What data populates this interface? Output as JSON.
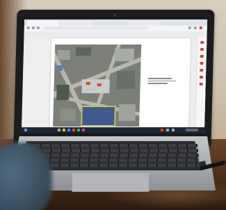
{
  "scene": {
    "subject": "laptop",
    "screen_content": "pdf-viewer-with-aerial-map",
    "colors": {
      "wall": "#d8cdbd",
      "desk": "#5a3a22",
      "laptop_lid": "#1c1c1e",
      "laptop_base": "#b3b5b8",
      "keyboard": "#2b2c2f",
      "taskbar": "#202734",
      "map_ground": "#7b7f77",
      "accent_red": "#e3402f"
    }
  }
}
